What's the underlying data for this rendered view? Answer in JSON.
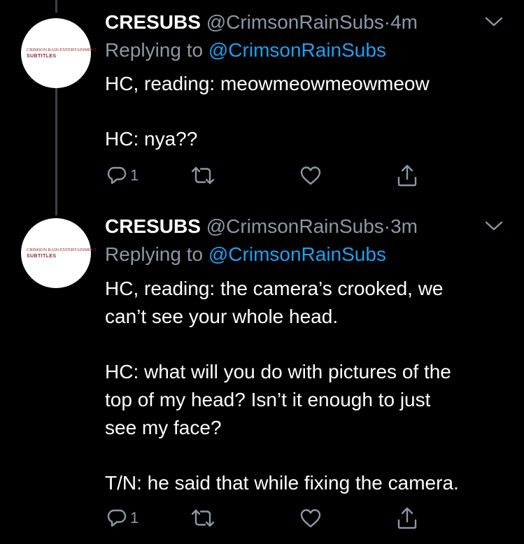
{
  "tweets": [
    {
      "display_name": "CRESUBS",
      "handle": "@CrimsonRainSubs",
      "dot": "·",
      "time": "4m",
      "replying_prefix": "Replying to ",
      "replying_handle": "@CrimsonRainSubs",
      "lines": [
        "HC, reading: meowmeowmeowmeow",
        "",
        "HC: nya??"
      ],
      "reply_count": "1",
      "avatar": {
        "logo_top": "CRIMSON RAIN ENTERTAINMENT",
        "logo_bottom": "SUBTITLES"
      }
    },
    {
      "display_name": "CRESUBS",
      "handle": "@CrimsonRainSubs",
      "dot": "·",
      "time": "3m",
      "replying_prefix": "Replying to ",
      "replying_handle": "@CrimsonRainSubs",
      "lines": [
        "HC, reading: the camera’s crooked, we",
        "can’t see your whole head.",
        "",
        "HC: what will you do with pictures of the",
        "top of my head? Isn’t it enough to just",
        "see my face?",
        "",
        "T/N: he said that while fixing the camera."
      ],
      "reply_count": "1",
      "avatar": {
        "logo_top": "CRIMSON RAIN ENTERTAINMENT",
        "logo_bottom": "SUBTITLES"
      }
    }
  ],
  "icons": {
    "reply": "reply-icon",
    "retweet": "retweet-icon",
    "like": "like-icon",
    "share": "share-icon",
    "chevron": "chevron-down-icon"
  },
  "colors": {
    "background": "#000000",
    "text": "#ffffff",
    "secondary": "#8b98a5",
    "link": "#1da1f2",
    "thread_line": "#3d4146",
    "brand": "#8f2a2a"
  }
}
